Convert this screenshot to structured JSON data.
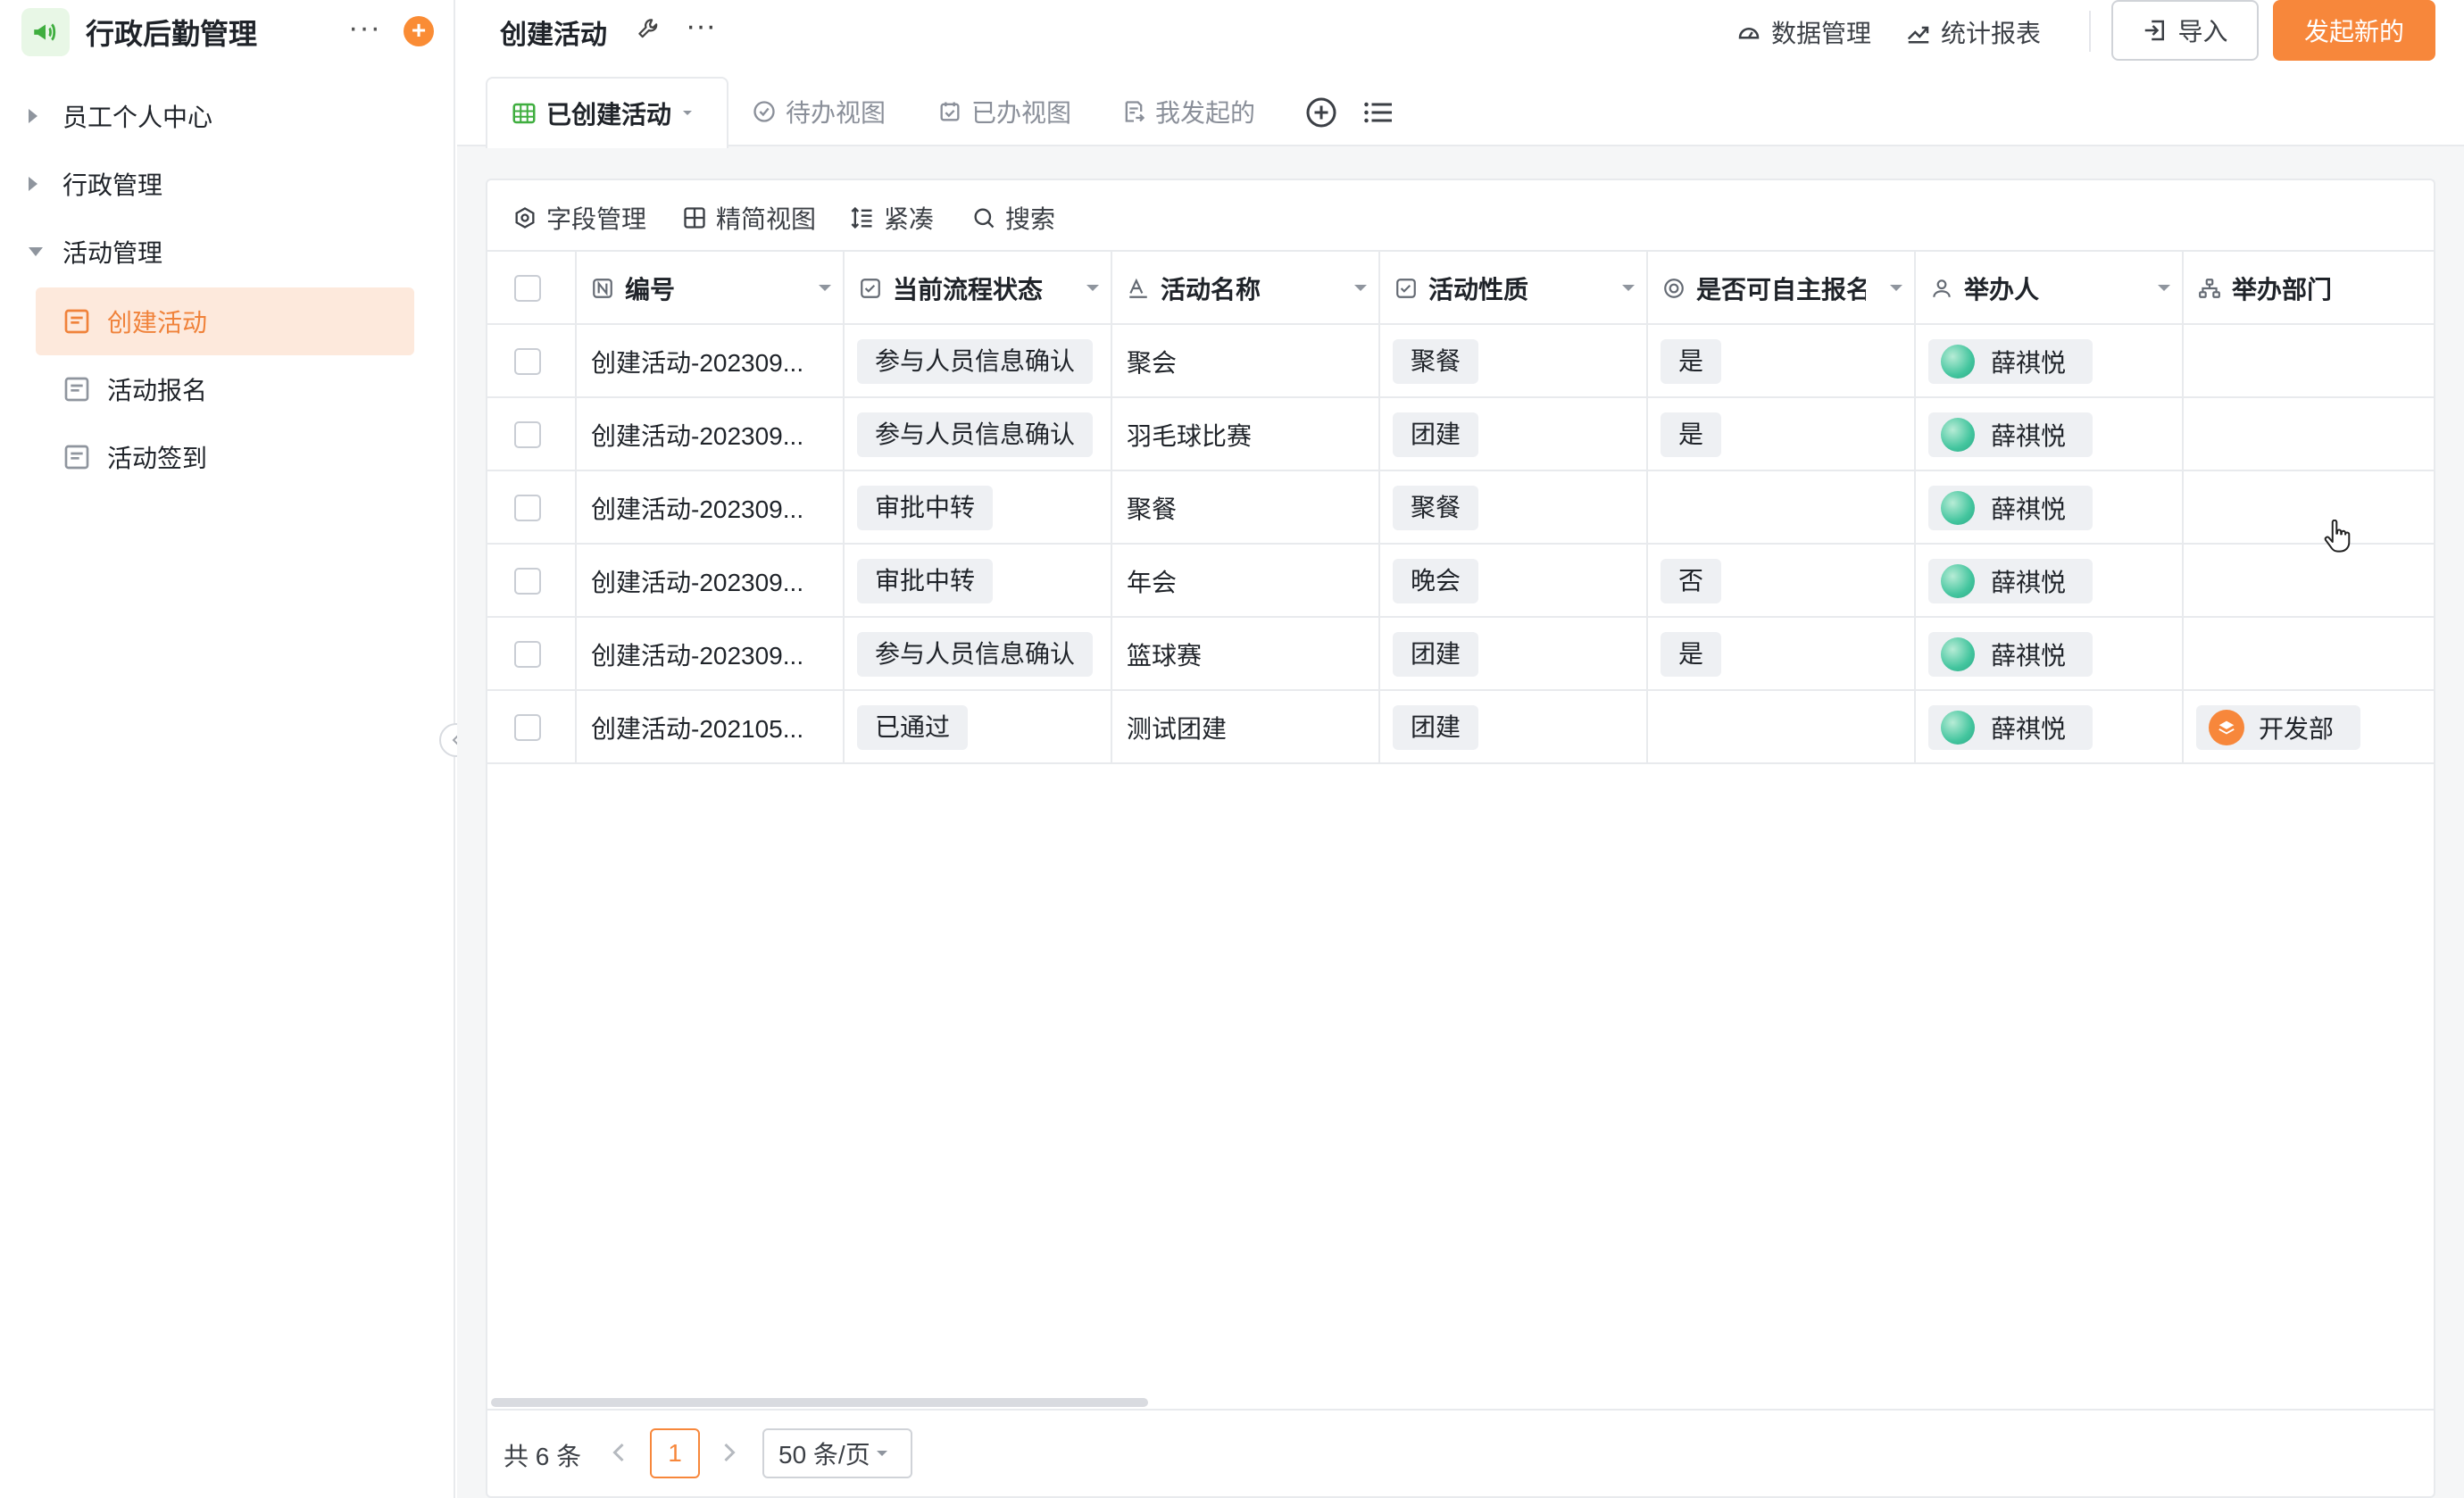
{
  "app": {
    "title": "行政后勤管理",
    "more": "···",
    "add": "+"
  },
  "sidebar": {
    "groups": [
      {
        "label": "员工个人中心",
        "expanded": false
      },
      {
        "label": "行政管理",
        "expanded": false
      },
      {
        "label": "活动管理",
        "expanded": true
      }
    ],
    "items": [
      {
        "label": "创建活动",
        "active": true
      },
      {
        "label": "活动报名",
        "active": false
      },
      {
        "label": "活动签到",
        "active": false
      }
    ]
  },
  "header": {
    "title": "创建活动",
    "more": "···",
    "data_manage": "数据管理",
    "reports": "统计报表",
    "import": "导入",
    "new": "发起新的"
  },
  "tabs": [
    {
      "label": "已创建活动",
      "active": true,
      "icon": "table-icon"
    },
    {
      "label": "待办视图",
      "active": false,
      "icon": "check-circle-icon"
    },
    {
      "label": "已办视图",
      "active": false,
      "icon": "calendar-check-icon"
    },
    {
      "label": "我发起的",
      "active": false,
      "icon": "send-doc-icon"
    }
  ],
  "toolbar": {
    "fields": "字段管理",
    "compact_view": "精简视图",
    "density": "紧凑",
    "search": "搜索"
  },
  "table": {
    "columns": [
      "编号",
      "当前流程状态",
      "活动名称",
      "活动性质",
      "是否可自主报名",
      "举办人",
      "举办部门"
    ],
    "rows": [
      {
        "id": "创建活动-202309...",
        "status": "参与人员信息确认",
        "name": "聚会",
        "type": "聚餐",
        "self": "是",
        "host": "薛祺悦",
        "dept": ""
      },
      {
        "id": "创建活动-202309...",
        "status": "参与人员信息确认",
        "name": "羽毛球比赛",
        "type": "团建",
        "self": "是",
        "host": "薛祺悦",
        "dept": ""
      },
      {
        "id": "创建活动-202309...",
        "status": "审批中转",
        "name": "聚餐",
        "type": "聚餐",
        "self": "",
        "host": "薛祺悦",
        "dept": ""
      },
      {
        "id": "创建活动-202309...",
        "status": "审批中转",
        "name": "年会",
        "type": "晚会",
        "self": "否",
        "host": "薛祺悦",
        "dept": ""
      },
      {
        "id": "创建活动-202309...",
        "status": "参与人员信息确认",
        "name": "篮球赛",
        "type": "团建",
        "self": "是",
        "host": "薛祺悦",
        "dept": ""
      },
      {
        "id": "创建活动-202105...",
        "status": "已通过",
        "name": "测试团建",
        "type": "团建",
        "self": "",
        "host": "薛祺悦",
        "dept": "开发部"
      }
    ]
  },
  "pagination": {
    "total": "共 6 条",
    "current": "1",
    "page_size": "50 条/页"
  },
  "colors": {
    "accent": "#f7873b",
    "active_bg": "#fde9dc",
    "border": "#e8eaed",
    "tag_bg": "#eef0f3"
  }
}
